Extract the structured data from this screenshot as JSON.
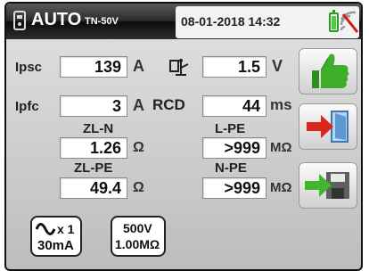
{
  "header": {
    "mode": "AUTO",
    "model": "TN-50V",
    "datetime": "08-01-2018 14:32"
  },
  "fields": {
    "ipsc": {
      "label": "Ipsc",
      "value": "139",
      "unit": "A"
    },
    "touch_voltage": {
      "value": "1.5",
      "unit": "V"
    },
    "ipfc": {
      "label": "Ipfc",
      "value": "3",
      "unit": "A"
    },
    "rcd": {
      "label": "RCD",
      "value": "44",
      "unit": "ms"
    },
    "zl_n": {
      "label": "ZL-N",
      "value": "1.26",
      "unit": "Ω"
    },
    "l_pe": {
      "label": "L-PE",
      "value": ">999",
      "unit": "MΩ"
    },
    "zl_pe": {
      "label": "ZL-PE",
      "value": "49.4",
      "unit": "Ω"
    },
    "n_pe": {
      "label": "N-PE",
      "value": ">999",
      "unit": "MΩ"
    }
  },
  "bottom": {
    "rcd_setting": {
      "multiplier": "x 1",
      "current": "30mA"
    },
    "insulation_setting": {
      "voltage": "500V",
      "limit": "1.00MΩ"
    }
  },
  "colors": {
    "ok_green": "#3fae2a",
    "exit_red": "#d9261c",
    "save_green": "#41b52d"
  }
}
